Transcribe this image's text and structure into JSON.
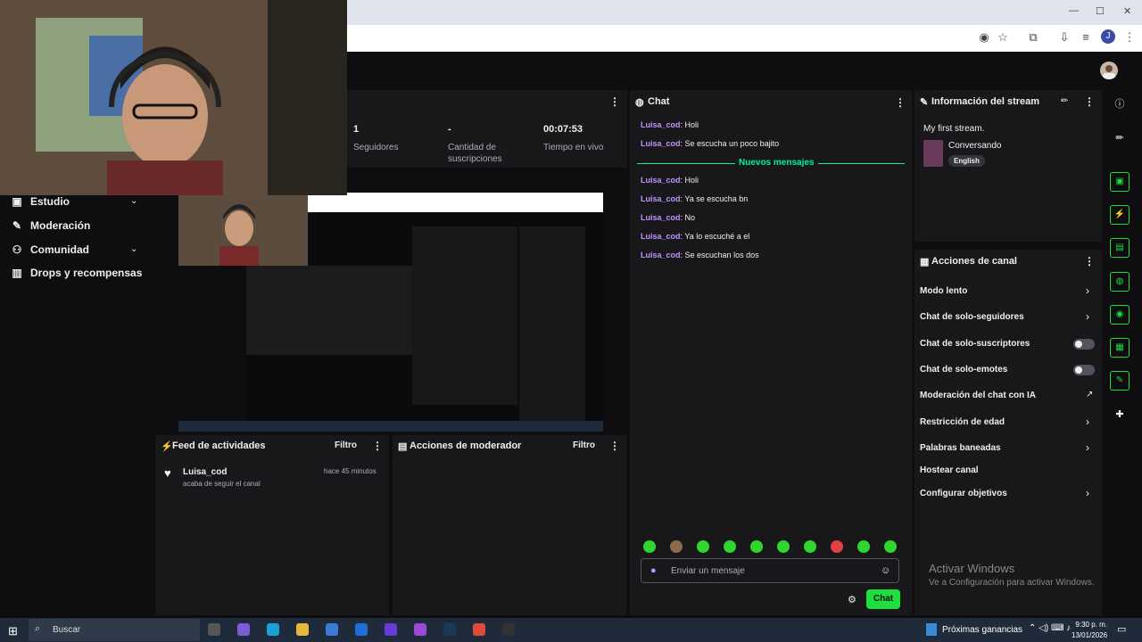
{
  "sidebar": {
    "items": [
      {
        "label": "Estudio",
        "icon": "studio-icon",
        "chevron": true
      },
      {
        "label": "Moderación",
        "icon": "wrench-icon",
        "chevron": false
      },
      {
        "label": "Comunidad",
        "icon": "community-icon",
        "chevron": true
      },
      {
        "label": "Drops y recompensas",
        "icon": "drops-icon",
        "chevron": false
      }
    ]
  },
  "stats": {
    "followers_value": "1",
    "followers_label": "Seguidores",
    "subs_value": "-",
    "subs_label": "Cantidad de suscripciones",
    "live_value": "00:07:53",
    "live_label": "Tiempo en vivo"
  },
  "chat": {
    "title": "Chat",
    "messages_before": [
      {
        "user": "Luisa_cod",
        "text": "Holi"
      },
      {
        "user": "Luisa_cod",
        "text": "Se escucha un poco bajito"
      }
    ],
    "new_messages_label": "Nuevos mensajes",
    "messages_after": [
      {
        "user": "Luisa_cod",
        "text": "Holi"
      },
      {
        "user": "Luisa_cod",
        "text": "Ya se escucha bn"
      },
      {
        "user": "Luisa_cod",
        "text": "No"
      },
      {
        "user": "Luisa_cod",
        "text": "Ya lo escuché a el"
      },
      {
        "user": "Luisa_cod",
        "text": "Se escuchan los dos"
      }
    ],
    "input_placeholder": "Enviar un mensaje",
    "send_label": "Chat"
  },
  "stream_info": {
    "title": "Información del stream",
    "stream_title": "My first stream.",
    "category": "Conversando",
    "language": "English"
  },
  "channel_actions": {
    "title": "Acciones de canal",
    "items": [
      {
        "label": "Modo lento",
        "control": "chevron"
      },
      {
        "label": "Chat de solo-seguidores",
        "control": "chevron"
      },
      {
        "label": "Chat de solo-suscriptores",
        "control": "toggle"
      },
      {
        "label": "Chat de solo-emotes",
        "control": "toggle"
      },
      {
        "label": "Moderación del chat con IA",
        "control": "external"
      },
      {
        "label": "Restricción de edad",
        "control": "chevron"
      },
      {
        "label": "Palabras baneadas",
        "control": "chevron"
      },
      {
        "label": "Hostear canal",
        "control": "none"
      },
      {
        "label": "Configurar objetivos",
        "control": "chevron"
      }
    ]
  },
  "activity_feed": {
    "title": "Feed de actividades",
    "filter_label": "Filtro",
    "items": [
      {
        "user": "Luisa_cod",
        "action": "acaba de seguir el canal",
        "time": "hace 45 minutos"
      }
    ]
  },
  "mod_actions": {
    "title": "Acciones de moderador",
    "filter_label": "Filtro"
  },
  "watermark": {
    "line1": "Activar Windows",
    "line2": "Ve a Configuración para activar Windows."
  },
  "taskbar": {
    "search_placeholder": "Buscar",
    "weather": "Próximas ganancias",
    "time": "9:30 p. m.",
    "date": "13/01/2026"
  },
  "colors": {
    "accent_green": "#1fdf3f",
    "username_purple": "#bf94ff",
    "new_messages_green": "#00f593",
    "panel_bg": "#18181b"
  }
}
